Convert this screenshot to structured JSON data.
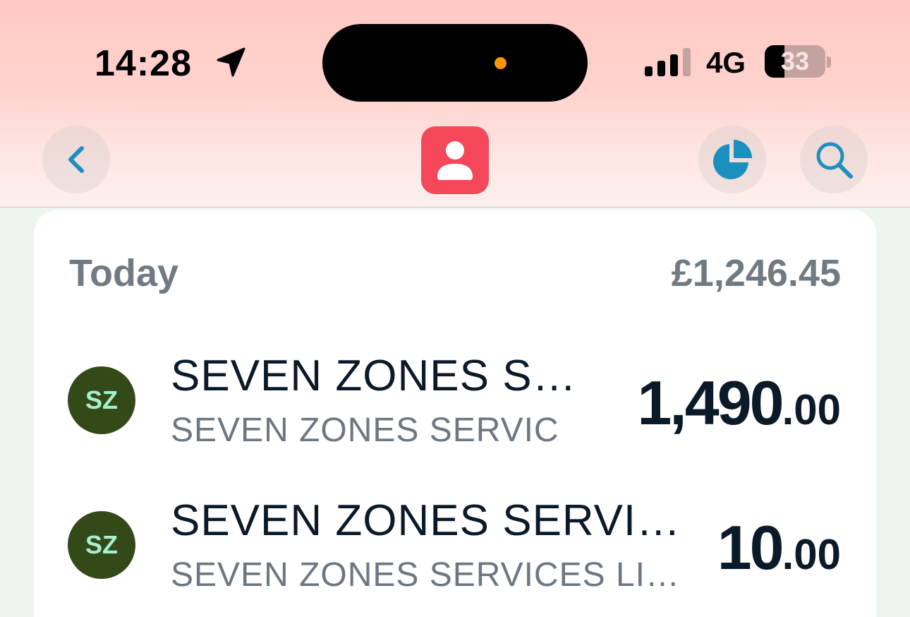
{
  "status_bar": {
    "time": "14:28",
    "network": "4G",
    "battery": "33",
    "battery_level": 0.33,
    "signal_bars": 3
  },
  "header": {
    "back_icon": "chevron-left-icon",
    "profile_icon": "person-icon",
    "chart_icon": "pie-chart-icon",
    "search_icon": "search-icon",
    "accent_color": "#1b8fbd",
    "profile_color": "#f5475a"
  },
  "section": {
    "title": "Today",
    "total": "£1,246.45"
  },
  "transactions": [
    {
      "initials": "SZ",
      "name": "SEVEN ZONES S…",
      "subtitle": "SEVEN ZONES SERVIC",
      "amount_major": "1,490",
      "amount_minor": ".00"
    },
    {
      "initials": "SZ",
      "name": "SEVEN ZONES SERVI…",
      "subtitle": "SEVEN ZONES SERVICES LI…",
      "amount_major": "10",
      "amount_minor": ".00"
    }
  ]
}
